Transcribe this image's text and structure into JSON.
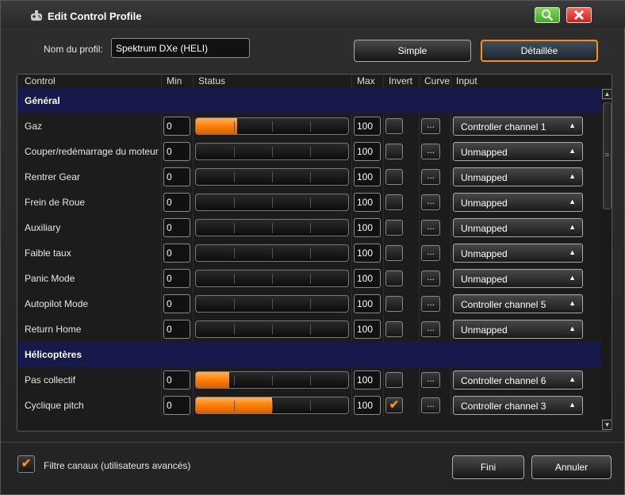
{
  "window": {
    "title": "Edit Control Profile"
  },
  "profile": {
    "label": "Nom du profil:",
    "value": "Spektrum DXe (HELI)"
  },
  "modes": {
    "simple": "Simple",
    "detailed": "Détaillée"
  },
  "columns": {
    "control": "Control",
    "min": "Min",
    "status": "Status",
    "max": "Max",
    "invert": "Invert",
    "curve": "Curve",
    "input": "Input"
  },
  "sections": [
    {
      "title": "Général",
      "rows": [
        {
          "label": "Gaz",
          "min": "0",
          "max": "100",
          "status": 0.27,
          "inverted": false,
          "curve": "...",
          "input": "Controller channel 1"
        },
        {
          "label": "Couper/redémarrage du moteur",
          "min": "0",
          "max": "100",
          "status": 0,
          "inverted": false,
          "curve": "...",
          "input": "Unmapped"
        },
        {
          "label": "Rentrer Gear",
          "min": "0",
          "max": "100",
          "status": 0,
          "inverted": false,
          "curve": "...",
          "input": "Unmapped"
        },
        {
          "label": "Frein de Roue",
          "min": "0",
          "max": "100",
          "status": 0,
          "inverted": false,
          "curve": "...",
          "input": "Unmapped"
        },
        {
          "label": "Auxiliary",
          "min": "0",
          "max": "100",
          "status": 0,
          "inverted": false,
          "curve": "...",
          "input": "Unmapped"
        },
        {
          "label": "Faible taux",
          "min": "0",
          "max": "100",
          "status": 0,
          "inverted": false,
          "curve": "...",
          "input": "Unmapped"
        },
        {
          "label": "Panic Mode",
          "min": "0",
          "max": "100",
          "status": 0,
          "inverted": false,
          "curve": "...",
          "input": "Unmapped"
        },
        {
          "label": "Autopilot Mode",
          "min": "0",
          "max": "100",
          "status": 0,
          "inverted": false,
          "curve": "...",
          "input": "Controller channel 5"
        },
        {
          "label": "Return Home",
          "min": "0",
          "max": "100",
          "status": 0,
          "inverted": false,
          "curve": "...",
          "input": "Unmapped"
        }
      ]
    },
    {
      "title": "Hélicoptères",
      "rows": [
        {
          "label": "Pas collectif",
          "min": "0",
          "max": "100",
          "status": 0.22,
          "inverted": false,
          "curve": "...",
          "input": "Controller channel 6"
        },
        {
          "label": "Cyclique pitch",
          "min": "0",
          "max": "100",
          "status": 0.5,
          "inverted": true,
          "curve": "...",
          "input": "Controller channel 3"
        }
      ]
    }
  ],
  "footer": {
    "filter_label": "Filtre canaux (utilisateurs avancés)",
    "filter_checked": true,
    "done": "Fini",
    "cancel": "Annuler"
  },
  "icons": {
    "search": "search-icon",
    "close": "close-icon",
    "app": "gamepad-icon"
  },
  "colors": {
    "accent": "#ff8c1a",
    "section_bg": "#17194a"
  }
}
